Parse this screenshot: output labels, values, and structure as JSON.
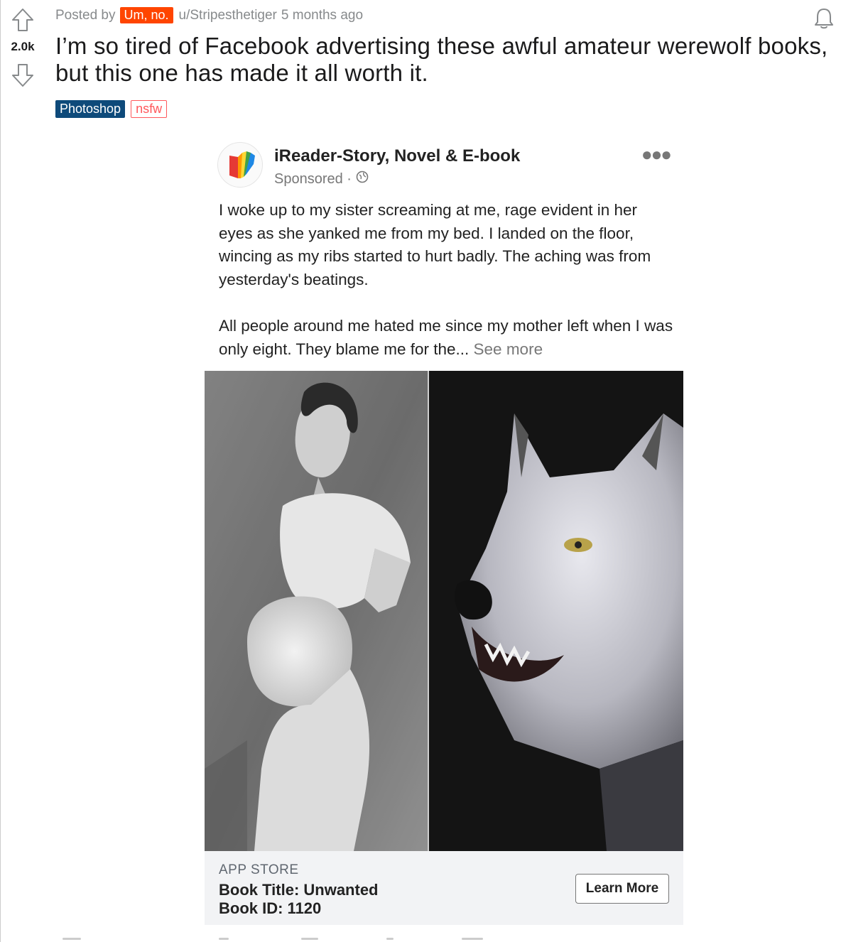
{
  "post": {
    "score": "2.0k",
    "posted_by_label": "Posted by",
    "user_flair": "Um, no.",
    "author": "u/Stripesthetiger",
    "time_ago": "5 months ago",
    "title": "I’m so tired of Facebook advertising these awful amateur werewolf books, but this one has made it all worth it.",
    "tags": [
      "Photoshop",
      "nsfw"
    ],
    "colors": {
      "user_flair_bg": "#ff4500",
      "photoshop_flair_bg": "#0e4a7a",
      "nsfw": "#ff585b"
    }
  },
  "ad": {
    "page_name": "iReader-Story, Novel & E-book",
    "sponsored": "Sponsored ·",
    "paragraph1": "I woke up to my sister screaming at me, rage evident in her eyes as she yanked me from my bed. I landed on the floor, wincing as my ribs started to hurt badly. The aching was from yesterday's beatings.",
    "paragraph2": "All people around me hated me since my mother left when I was only eight. They blame me for the...",
    "see_more": "See more",
    "footer": {
      "store": "APP STORE",
      "book_title": "Book Title: Unwanted",
      "book_id": "Book ID: 1120",
      "cta": "Learn More"
    }
  },
  "icons": [
    "upvote-icon",
    "downvote-icon",
    "bell-icon",
    "globe-icon",
    "more-icon",
    "ireader-logo-icon"
  ]
}
